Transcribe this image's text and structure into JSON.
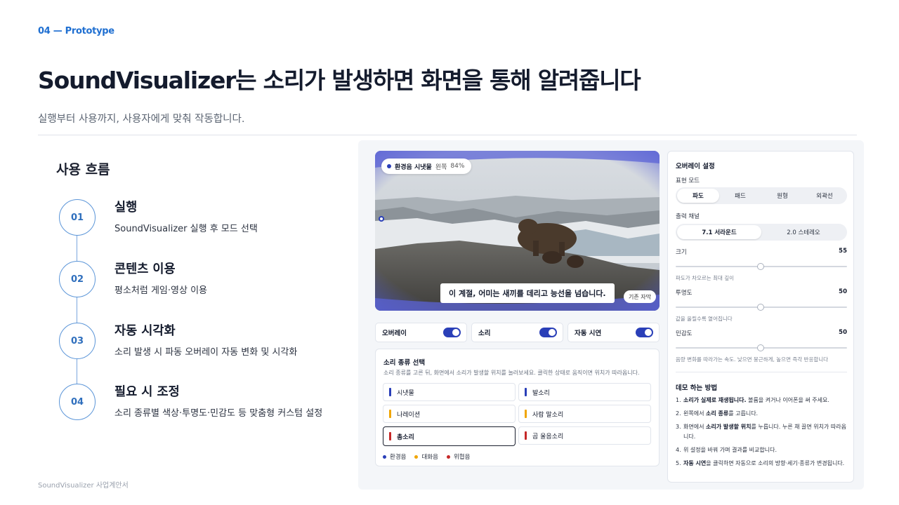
{
  "header": {
    "eyebrow": "04 — Prototype",
    "title": "SoundVisualizer는 소리가 발생하면 화면을 통해 알려줍니다",
    "subtitle": "실행부터 사용까지, 사용자에게 맞춰 작동합니다."
  },
  "flow": {
    "title": "사용 흐름",
    "steps": [
      {
        "num": "01",
        "title": "실행",
        "desc": "SoundVisualizer 실행 후 모드 선택"
      },
      {
        "num": "02",
        "title": "콘텐츠 이용",
        "desc": "평소처럼 게임·영상 이용"
      },
      {
        "num": "03",
        "title": "자동 시각화",
        "desc": "소리 발생 시 파동 오버레이 자동 변화 및 시각화"
      },
      {
        "num": "04",
        "title": "필요 시 조정",
        "desc": "소리 종류별 색상·투명도·민감도 등 맞춤형 커스텀 설정"
      }
    ]
  },
  "footer": "SoundVisualizer 사업계안서",
  "video": {
    "pill_name": "환경음 시냇물",
    "pill_direction": "왼쪽",
    "pill_percent": "84%",
    "caption": "이 계절, 어미는 새끼를 데리고 능선을 넘습니다.",
    "cc_button": "기존 자막"
  },
  "toggles": [
    {
      "label": "오버레이",
      "on": true
    },
    {
      "label": "소리",
      "on": true
    },
    {
      "label": "자동 시연",
      "on": true
    }
  ],
  "sound_types": {
    "title": "소리 종류 선택",
    "desc": "소리 종류를 고른 뒤, 화면에서 소리가 발생할 위치를 눌러보세요. 클릭한 상태로 움직이면 위치가 따라옵니다.",
    "items": [
      {
        "label": "시냇물",
        "color": "#2a3fb8"
      },
      {
        "label": "발소리",
        "color": "#2a3fb8"
      },
      {
        "label": "나레이션",
        "color": "#f0a500"
      },
      {
        "label": "사람 말소리",
        "color": "#f0a500"
      },
      {
        "label": "총소리",
        "color": "#c62828"
      },
      {
        "label": "곰 울음소리",
        "color": "#c62828"
      }
    ],
    "selected": "총소리",
    "legend": [
      {
        "label": "환경음",
        "color": "#2a3fb8"
      },
      {
        "label": "대화음",
        "color": "#f0a500"
      },
      {
        "label": "위협음",
        "color": "#c62828"
      }
    ]
  },
  "settings": {
    "title": "오버레이 설정",
    "mode_label": "표현 모드",
    "modes": [
      "파도",
      "패드",
      "원형",
      "외곽선"
    ],
    "mode_selected": "파도",
    "channel_label": "출력 채널",
    "channels": [
      "7.1 서라운드",
      "2.0 스테레오"
    ],
    "channel_selected": "7.1 서라운드",
    "sliders": [
      {
        "label": "크기",
        "value": 55,
        "hint": "파도가 차오르는 최대 깊이",
        "fill": 0.5
      },
      {
        "label": "투명도",
        "value": 50,
        "hint": "값을 올릴수록 옅어집니다",
        "fill": 0.5
      },
      {
        "label": "민감도",
        "value": 50,
        "hint": "음량 변화를 따라가는 속도. 낮으면 뭉근하게, 높으면 즉각 반응합니다",
        "fill": 0.5
      }
    ],
    "demo_title": "데모 하는 방법",
    "demo_steps": [
      {
        "n": "1.",
        "bold": "소리가 실제로 재생됩니다.",
        "text": " 볼륨을 켜거나 이어폰을 써 주세요."
      },
      {
        "n": "2.",
        "pre": "왼쪽에서 ",
        "bold": "소리 종류",
        "text": "를 고릅니다."
      },
      {
        "n": "3.",
        "pre": "화면에서 ",
        "bold": "소리가 발생할 위치",
        "text": "를 누릅니다. 누른 채 끌면 위치가 따라옵니다."
      },
      {
        "n": "4.",
        "pre": "",
        "bold": "",
        "text": "위 설정을 바꿔 가며 결과를 비교합니다."
      },
      {
        "n": "5.",
        "pre": "",
        "bold": "자동 시연",
        "text": "을 클릭하면 자동으로 소리의 방향·세기·종류가 변경됩니다."
      }
    ]
  }
}
